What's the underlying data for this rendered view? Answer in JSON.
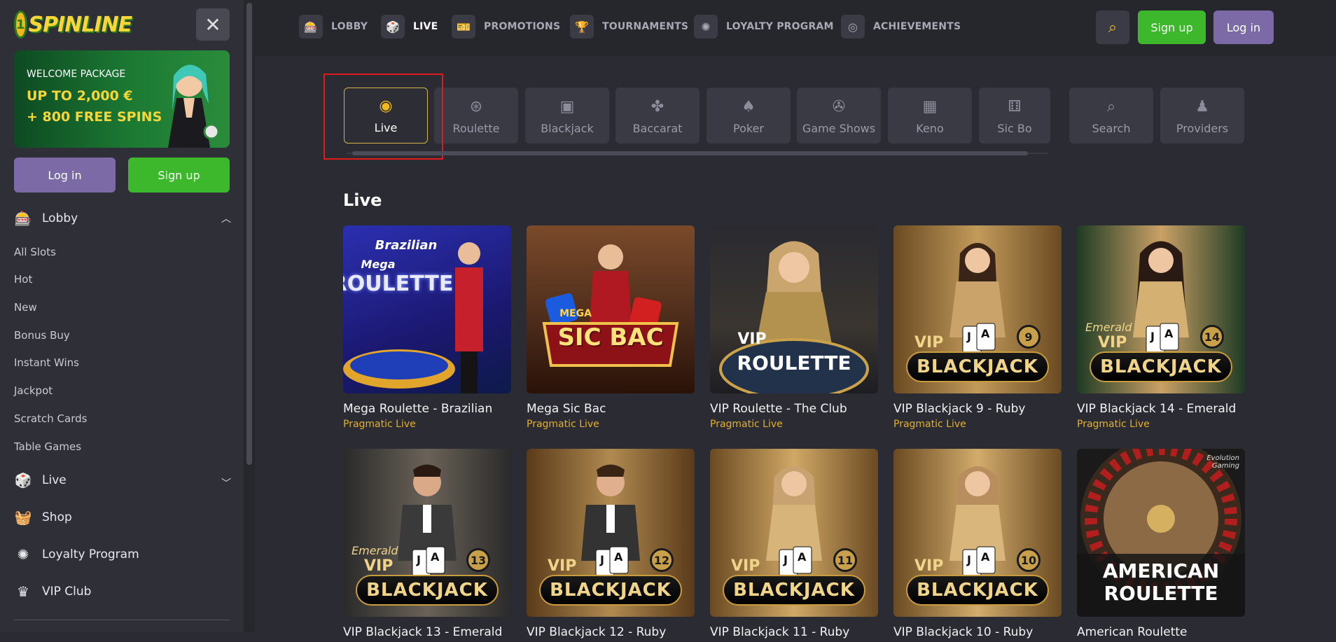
{
  "brand": {
    "logo_text": "SPINLINE",
    "logo_mark": "1"
  },
  "sidebar": {
    "promo": {
      "line1": "WELCOME PACKAGE",
      "line2": "UP TO 2,000 €",
      "line3": "+ 800 FREE SPINS"
    },
    "login_label": "Log in",
    "signup_label": "Sign up",
    "lobby": {
      "label": "Lobby",
      "icon": "slot-machine-icon"
    },
    "sub_items": [
      "All Slots",
      "Hot",
      "New",
      "Bonus Buy",
      "Instant Wins",
      "Jackpot",
      "Scratch Cards",
      "Table Games"
    ],
    "items": [
      {
        "label": "Live",
        "icon": "live-dealer-icon"
      },
      {
        "label": "Shop",
        "icon": "basket-icon"
      },
      {
        "label": "Loyalty Program",
        "icon": "laurel-icon"
      },
      {
        "label": "VIP Club",
        "icon": "crown-icon"
      }
    ]
  },
  "topnav": {
    "items": [
      {
        "label": "LOBBY",
        "icon": "slot-machine-icon"
      },
      {
        "label": "LIVE",
        "icon": "live-dealer-icon"
      },
      {
        "label": "PROMOTIONS",
        "icon": "ticket-icon"
      },
      {
        "label": "TOURNAMENTS",
        "icon": "trophy-icon"
      },
      {
        "label": "LOYALTY PROGRAM",
        "icon": "laurel-icon"
      },
      {
        "label": "ACHIEVEMENTS",
        "icon": "target-icon"
      }
    ],
    "signup_label": "Sign up",
    "login_label": "Log in"
  },
  "categories": [
    "Live",
    "Roulette",
    "Blackjack",
    "Baccarat",
    "Poker",
    "Game Shows",
    "Keno",
    "Sic Bo",
    "Search",
    "Providers"
  ],
  "section_title": "Live",
  "games": [
    {
      "name": "Mega Roulette - Brazilian",
      "provider": "Pragmatic Live",
      "art": "Brazilian",
      "art2": "Mega",
      "art3": "ROULETTE"
    },
    {
      "name": "Mega Sic Bac",
      "provider": "Pragmatic Live",
      "art": "MEGA",
      "art2": "SIC BAC"
    },
    {
      "name": "VIP Roulette - The Club",
      "provider": "Pragmatic Live",
      "art": "VIP",
      "art2": "ROULETTE"
    },
    {
      "name": "VIP Blackjack 9 - Ruby",
      "provider": "Pragmatic Live",
      "num": "9"
    },
    {
      "name": "VIP Blackjack 14 - Emerald",
      "provider": "Pragmatic Live",
      "num": "14",
      "tag": "Emerald"
    },
    {
      "name": "VIP Blackjack 13 - Emerald",
      "provider": "",
      "num": "13",
      "tag": "Emerald"
    },
    {
      "name": "VIP Blackjack 12 - Ruby",
      "provider": "",
      "num": "12"
    },
    {
      "name": "VIP Blackjack 11 - Ruby",
      "provider": "",
      "num": "11"
    },
    {
      "name": "VIP Blackjack 10 - Ruby",
      "provider": "",
      "num": "10"
    },
    {
      "name": "American Roulette",
      "provider": "",
      "art": "AMERICAN",
      "art2": "ROULETTE",
      "brand": "Evolution Gaming"
    }
  ],
  "blackjack_word": "BLACKJACK",
  "vip_word": "VIP",
  "colors": {
    "accent_green": "#3db82c",
    "accent_purple": "#7b6aa5",
    "gold": "#e3b02c",
    "highlight": "#e01b1b"
  }
}
